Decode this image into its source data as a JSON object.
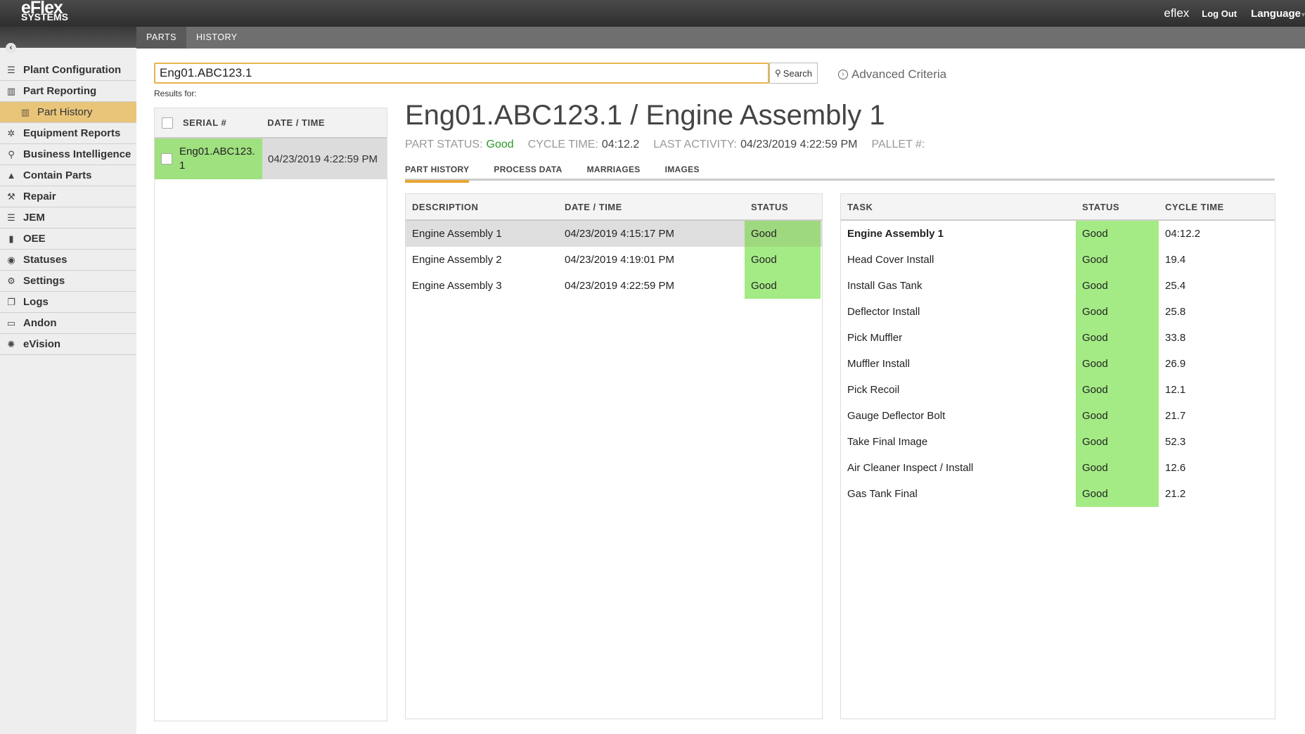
{
  "header": {
    "logo_line1": "eFlex",
    "logo_line2": "SYSTEMS",
    "user": "eflex",
    "logout": "Log Out",
    "language": "Language"
  },
  "tabs": [
    {
      "label": "PARTS"
    },
    {
      "label": "HISTORY"
    }
  ],
  "sidebar": {
    "items": [
      {
        "label": "Plant Configuration",
        "icon": "list-icon"
      },
      {
        "label": "Part Reporting",
        "icon": "bar-chart-icon"
      },
      {
        "label": "Part History",
        "icon": "barcode-icon",
        "active": true
      },
      {
        "label": "Equipment Reports",
        "icon": "cogs-icon"
      },
      {
        "label": "Business Intelligence",
        "icon": "search-icon"
      },
      {
        "label": "Contain Parts",
        "icon": "warning-icon"
      },
      {
        "label": "Repair",
        "icon": "wrench-icon"
      },
      {
        "label": "JEM",
        "icon": "list-icon"
      },
      {
        "label": "OEE",
        "icon": "signal-icon"
      },
      {
        "label": "Statuses",
        "icon": "circle-icon"
      },
      {
        "label": "Settings",
        "icon": "gear-icon"
      },
      {
        "label": "Logs",
        "icon": "copy-icon"
      },
      {
        "label": "Andon",
        "icon": "monitor-icon"
      },
      {
        "label": "eVision",
        "icon": "aperture-icon"
      }
    ]
  },
  "search": {
    "value": "Eng01.ABC123.1",
    "button": "Search",
    "advanced": "Advanced Criteria",
    "results_for": "Results for:"
  },
  "serial_list": {
    "headers": {
      "serial": "SERIAL #",
      "datetime": "DATE / TIME"
    },
    "rows": [
      {
        "serial": "Eng01.ABC123.1",
        "datetime": "04/23/2019 4:22:59 PM"
      }
    ]
  },
  "detail": {
    "title": "Eng01.ABC123.1 / Engine Assembly 1",
    "part_status_label": "PART STATUS:",
    "part_status": "Good",
    "cycle_time_label": "CYCLE TIME:",
    "cycle_time": "04:12.2",
    "last_activity_label": "LAST ACTIVITY:",
    "last_activity": "04/23/2019 4:22:59 PM",
    "pallet_label": "PALLET #:",
    "tabs": [
      {
        "label": "PART HISTORY"
      },
      {
        "label": "PROCESS DATA"
      },
      {
        "label": "MARRIAGES"
      },
      {
        "label": "IMAGES"
      }
    ]
  },
  "history_table": {
    "headers": {
      "description": "DESCRIPTION",
      "datetime": "DATE / TIME",
      "status": "STATUS"
    },
    "rows": [
      {
        "description": "Engine Assembly 1",
        "datetime": "04/23/2019 4:15:17 PM",
        "status": "Good"
      },
      {
        "description": "Engine Assembly 2",
        "datetime": "04/23/2019 4:19:01 PM",
        "status": "Good"
      },
      {
        "description": "Engine Assembly 3",
        "datetime": "04/23/2019 4:22:59 PM",
        "status": "Good"
      }
    ]
  },
  "task_table": {
    "headers": {
      "task": "TASK",
      "status": "STATUS",
      "cycle": "CYCLE TIME"
    },
    "rows": [
      {
        "task": "Engine Assembly 1",
        "status": "Good",
        "cycle": "04:12.2"
      },
      {
        "task": "Head Cover Install",
        "status": "Good",
        "cycle": "19.4"
      },
      {
        "task": "Install Gas Tank",
        "status": "Good",
        "cycle": "25.4"
      },
      {
        "task": "Deflector Install",
        "status": "Good",
        "cycle": "25.8"
      },
      {
        "task": "Pick Muffler",
        "status": "Good",
        "cycle": "33.8"
      },
      {
        "task": "Muffler Install",
        "status": "Good",
        "cycle": "26.9"
      },
      {
        "task": "Pick Recoil",
        "status": "Good",
        "cycle": "12.1"
      },
      {
        "task": "Gauge Deflector Bolt",
        "status": "Good",
        "cycle": "21.7"
      },
      {
        "task": "Take Final Image",
        "status": "Good",
        "cycle": "52.3"
      },
      {
        "task": "Air Cleaner Inspect / Install",
        "status": "Good",
        "cycle": "12.6"
      },
      {
        "task": "Gas Tank Final",
        "status": "Good",
        "cycle": "21.2"
      }
    ]
  },
  "colors": {
    "accent": "#e8b54d",
    "good": "#a4eb85",
    "selected_row": "#9fe07f",
    "sidebar_active": "#e9c57a"
  }
}
